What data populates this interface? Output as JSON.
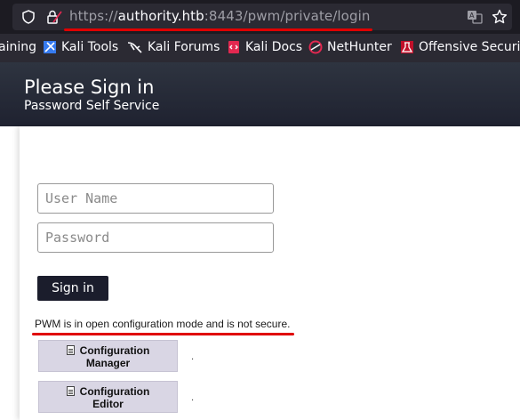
{
  "browser": {
    "url_prefix": "https://",
    "url_host": "authority.htb",
    "url_rest": ":8443/pwm/private/login"
  },
  "bookmarks": [
    {
      "label": "aining"
    },
    {
      "label": "Kali Tools"
    },
    {
      "label": "Kali Forums"
    },
    {
      "label": "Kali Docs"
    },
    {
      "label": "NetHunter"
    },
    {
      "label": "Offensive Security"
    }
  ],
  "header": {
    "title": "Please Sign in",
    "subtitle": "Password Self Service"
  },
  "form": {
    "username_placeholder": "User Name",
    "password_placeholder": "Password",
    "signin_label": "Sign in"
  },
  "warning_text": "PWM is in open configuration mode and is not secure.",
  "config_buttons": [
    {
      "line1": "Configuration",
      "line2": "Manager"
    },
    {
      "line1": "Configuration",
      "line2": "Editor"
    }
  ],
  "colors": {
    "header_bg": "#1f2230",
    "signin_bg": "#1b1d2c",
    "config_btn_bg": "#d9d6e4",
    "annotation_red": "#e00000"
  }
}
